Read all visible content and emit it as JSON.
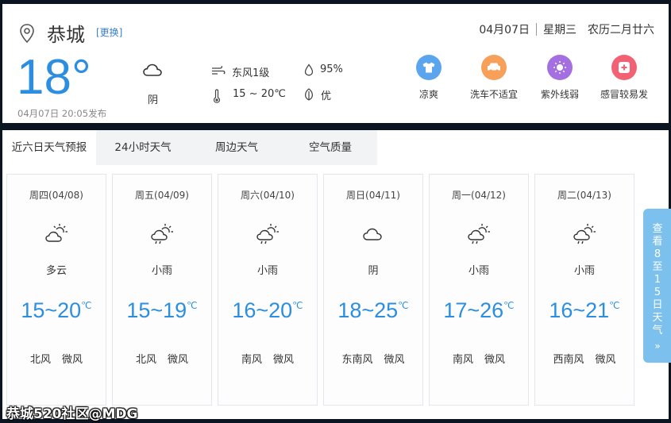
{
  "header": {
    "city": "恭城",
    "change_label": "[更换]",
    "date": "04月07日",
    "weekday": "星期三",
    "lunar": "农历二月廿六"
  },
  "current": {
    "temperature": "18°",
    "publish_time": "04月07日 20:05发布",
    "condition": "阴",
    "condition_icon": "cloud-icon",
    "wind": "东风1级",
    "humidity": "95%",
    "temp_range": "15 ~ 20℃",
    "air_quality": "优"
  },
  "life_indices": [
    {
      "label": "凉爽",
      "icon": "clothing-icon",
      "color": "#5aa5ee"
    },
    {
      "label": "洗车不适宜",
      "icon": "car-icon",
      "color": "#f6a05a"
    },
    {
      "label": "紫外线弱",
      "icon": "sun-icon",
      "color": "#a46fe0"
    },
    {
      "label": "感冒较易发",
      "icon": "medical-icon",
      "color": "#f26274"
    }
  ],
  "tabs": [
    {
      "label": "近六日天气预报",
      "active": true
    },
    {
      "label": "24小时天气",
      "active": false
    },
    {
      "label": "周边天气",
      "active": false
    },
    {
      "label": "空气质量",
      "active": false
    }
  ],
  "forecast": [
    {
      "day": "周四(04/08)",
      "condition": "多云",
      "icon": "partly-cloudy-icon",
      "temp": "15~20",
      "unit": "℃",
      "wind_dir": "北风",
      "wind_level": "微风"
    },
    {
      "day": "周五(04/09)",
      "condition": "小雨",
      "icon": "light-rain-icon",
      "temp": "15~19",
      "unit": "℃",
      "wind_dir": "北风",
      "wind_level": "微风"
    },
    {
      "day": "周六(04/10)",
      "condition": "小雨",
      "icon": "light-rain-icon",
      "temp": "16~20",
      "unit": "℃",
      "wind_dir": "南风",
      "wind_level": "微风"
    },
    {
      "day": "周日(04/11)",
      "condition": "阴",
      "icon": "cloud-icon",
      "temp": "18~25",
      "unit": "℃",
      "wind_dir": "东南风",
      "wind_level": "微风"
    },
    {
      "day": "周一(04/12)",
      "condition": "小雨",
      "icon": "light-rain-icon",
      "temp": "17~26",
      "unit": "℃",
      "wind_dir": "南风",
      "wind_level": "微风"
    },
    {
      "day": "周二(04/13)",
      "condition": "小雨",
      "icon": "light-rain-icon",
      "temp": "16~21",
      "unit": "℃",
      "wind_dir": "西南风",
      "wind_level": "微风"
    }
  ],
  "more_button": {
    "label": "查看8至15日天气",
    "chevron": "»"
  },
  "watermark": "恭城520社区@MDG",
  "colors": {
    "accent": "#2b8ee0",
    "link": "#3a7ec8"
  }
}
